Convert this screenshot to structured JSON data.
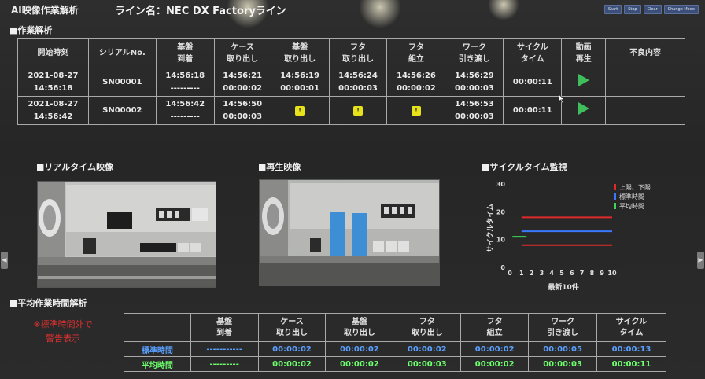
{
  "header": {
    "app_title": "AI映像作業解析",
    "line_name": "ライン名：NEC DX Factoryライン",
    "buttons": [
      "Start",
      "Stop",
      "Clear",
      "Change Mode"
    ]
  },
  "work_analysis": {
    "section_title": "■作業解析",
    "columns": [
      [
        "開始時刻"
      ],
      [
        "シリアルNo."
      ],
      [
        "基盤",
        "到着"
      ],
      [
        "ケース",
        "取り出し"
      ],
      [
        "基盤",
        "取り出し"
      ],
      [
        "フタ",
        "取り出し"
      ],
      [
        "フタ",
        "組立"
      ],
      [
        "ワーク",
        "引き渡し"
      ],
      [
        "サイクル",
        "タイム"
      ],
      [
        "動画",
        "再生"
      ],
      [
        "不良内容"
      ]
    ],
    "rows": [
      {
        "start": [
          "2021-08-27",
          "14:56:18"
        ],
        "serial": "SN00001",
        "arrival": [
          "14:56:18",
          "---------"
        ],
        "case": [
          "14:56:21",
          "00:00:02"
        ],
        "board": [
          "14:56:19",
          "00:00:01"
        ],
        "lid_take": [
          "14:56:24",
          "00:00:03"
        ],
        "lid_assy": [
          "14:56:26",
          "00:00:02"
        ],
        "handover": [
          "14:56:29",
          "00:00:03"
        ],
        "cycle": "00:00:11",
        "defect": ""
      },
      {
        "start": [
          "2021-08-27",
          "14:56:42"
        ],
        "serial": "SN00002",
        "arrival": [
          "14:56:42",
          "---------"
        ],
        "case": [
          "14:56:50",
          "00:00:03"
        ],
        "board_warn": "!",
        "lid_take_warn": "!",
        "lid_assy_warn": "!",
        "handover": [
          "14:56:53",
          "00:00:03"
        ],
        "cycle": "00:00:11",
        "defect": ""
      }
    ]
  },
  "realtime": {
    "title": "■リアルタイム映像"
  },
  "playback": {
    "title": "■再生映像"
  },
  "cycle_monitor": {
    "title": "■サイクルタイム監視"
  },
  "chart_data": {
    "type": "line",
    "title": "■サイクルタイム監視",
    "xlabel": "最新10件",
    "ylabel": "サイクルタイム",
    "x": [
      1,
      2,
      3,
      4,
      5,
      6,
      7,
      8,
      9,
      10
    ],
    "xlim": [
      0,
      10
    ],
    "ylim": [
      0,
      30
    ],
    "yticks": [
      0,
      10,
      20,
      30
    ],
    "series": [
      {
        "name": "上限、下限",
        "color": "#e02a2a",
        "values": [
          [
            18,
            18
          ],
          [
            8,
            8
          ]
        ],
        "x_range": [
          1,
          10
        ]
      },
      {
        "name": "標準時間",
        "color": "#3a78ff",
        "values": [
          13,
          13
        ],
        "x_range": [
          1,
          10
        ]
      },
      {
        "name": "平均時間",
        "color": "#3cd65a",
        "values": [
          11,
          11
        ],
        "x_range": [
          0.1,
          1.5
        ]
      }
    ],
    "legend": "top-right"
  },
  "avg_analysis": {
    "section_title": "■平均作業時間解析",
    "note_line1": "※標準時間外で",
    "note_line2": "警告表示",
    "columns": [
      [
        "基盤",
        "到着"
      ],
      [
        "ケース",
        "取り出し"
      ],
      [
        "基盤",
        "取り出し"
      ],
      [
        "フタ",
        "取り出し"
      ],
      [
        "フタ",
        "組立"
      ],
      [
        "ワーク",
        "引き渡し"
      ],
      [
        "サイクル",
        "タイム"
      ]
    ],
    "rows": [
      {
        "label": "標準時間",
        "values": [
          "-----------",
          "00:00:02",
          "00:00:02",
          "00:00:02",
          "00:00:02",
          "00:00:05",
          "00:00:13"
        ]
      },
      {
        "label": "平均時間",
        "values": [
          "---------",
          "00:00:02",
          "00:00:02",
          "00:00:03",
          "00:00:02",
          "00:00:03",
          "00:00:11"
        ]
      }
    ]
  }
}
